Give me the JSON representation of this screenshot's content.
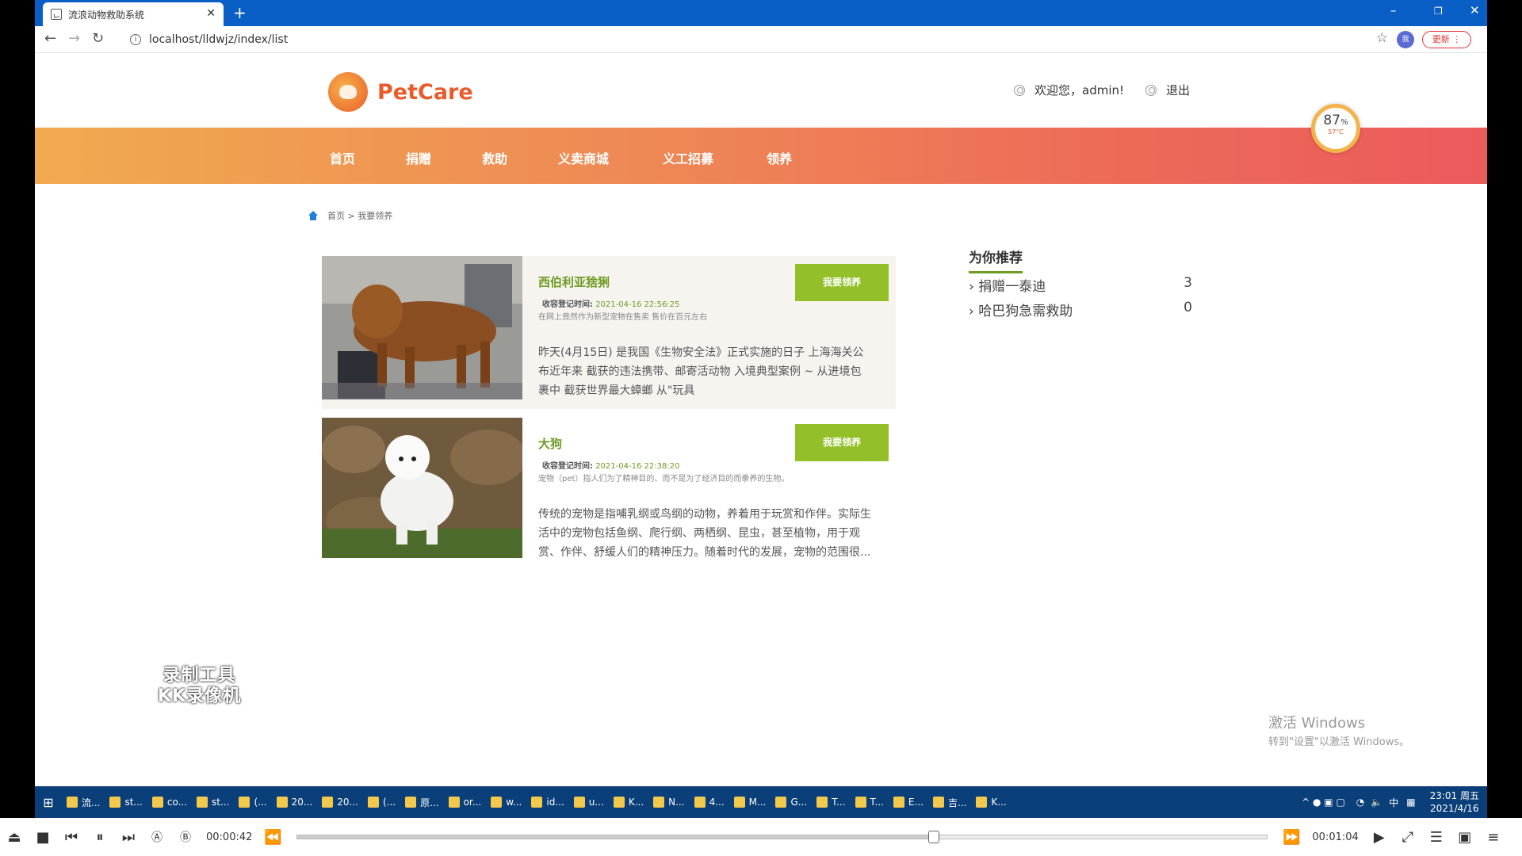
{
  "browser": {
    "tab_title": "流浪动物救助系统",
    "url": "localhost/lldwjz/index/list",
    "update_label": "更新",
    "profile_initials": "我"
  },
  "site": {
    "logo_text": "PetCare",
    "welcome": "欢迎您，admin!",
    "logout": "退出",
    "nav": [
      "首页",
      "捐赠",
      "救助",
      "义卖商城",
      "义工招募",
      "领养"
    ],
    "breadcrumb": "首页 > 我要领养"
  },
  "gauge": {
    "percent": "87",
    "unit": "%",
    "temp": "57°C"
  },
  "pets": [
    {
      "name": "西伯利亚猞猁",
      "time_label": "收容登记时间:",
      "time": "2021-04-16 22:56:25",
      "sub": "在网上竟然作为新型宠物在售卖 售价在百元左右",
      "desc": "昨天(4月15日) 是我国《生物安全法》正式实施的日子 上海海关公布近年来 截获的违法携带、邮寄活动物 入境典型案例 ~ 从进境包裹中 截获世界最大蟑螂 从\"玩具",
      "button": "我要领养"
    },
    {
      "name": "大狗",
      "time_label": "收容登记时间:",
      "time": "2021-04-16 22:38:20",
      "sub": "宠物（pet）指人们为了精神目的、而不是为了经济目的而豢养的生物。",
      "desc": "传统的宠物是指哺乳纲或鸟纲的动物，养着用于玩赏和作伴。实际生活中的宠物包括鱼纲、爬行纲、两栖纲、昆虫，甚至植物，用于观赏、作伴、舒缓人们的精神压力。随着时代的发展，宠物的范围很...",
      "button": "我要领养"
    }
  ],
  "recommend": {
    "title": "为你推荐",
    "items": [
      {
        "label": "捐赠一泰迪",
        "count": "3"
      },
      {
        "label": "哈巴狗急需救助",
        "count": "0"
      }
    ]
  },
  "overlay": {
    "watermark_line1": "录制工具",
    "watermark_line2": "KK录像机",
    "activate_title": "激活 Windows",
    "activate_sub": "转到\"设置\"以激活 Windows。"
  },
  "taskbar": {
    "items": [
      "流...",
      "st...",
      "co...",
      "st...",
      "(...",
      "20...",
      "20...",
      "(...",
      "原...",
      "or...",
      "w...",
      "id...",
      "u...",
      "K...",
      "N...",
      "4...",
      "M...",
      "G...",
      "T...",
      "T...",
      "E...",
      "吉...",
      "K..."
    ],
    "ime": "中",
    "time": "23:01 周五",
    "date": "2021/4/16"
  },
  "player": {
    "elapsed": "00:00:42",
    "total": "00:01:04",
    "progress": 0.656
  },
  "colors": {
    "accent": "#93c029",
    "brand": "#ea5b2b",
    "nav_start": "#f1aa4f",
    "nav_end": "#eb5b5c"
  }
}
